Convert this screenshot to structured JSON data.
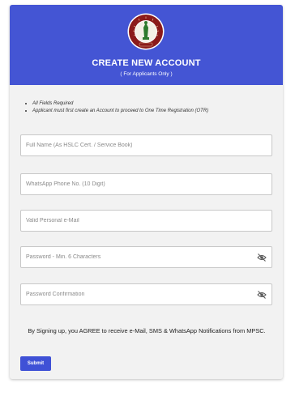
{
  "header": {
    "title": "CREATE NEW ACCOUNT",
    "subtitle": "( For Applicants Only )",
    "emblem_icon": "commission-emblem"
  },
  "notes": [
    "All Fields Required",
    "Applicant must first create an Account to proceed to One Time Registration (OTR)"
  ],
  "form": {
    "full_name_placeholder": "Full Name (As HSLC Cert. / Service Book)",
    "whatsapp_placeholder": "WhatsApp Phone No. (10 Digit)",
    "email_placeholder": "Valid Personal e-Mail",
    "password_placeholder": "Password - Min. 6 Characters",
    "password_confirm_placeholder": "Password Confirmation",
    "eye_icon": "eye-slash-icon"
  },
  "agreement": "By Signing up, you AGREE to receive e-Mail, SMS & WhatsApp Notifications from MPSC.",
  "submit_label": "Submit",
  "colors": {
    "header_bg": "#4455d4",
    "button_bg": "#3f51d6",
    "card_bg": "#f2f2f2"
  }
}
